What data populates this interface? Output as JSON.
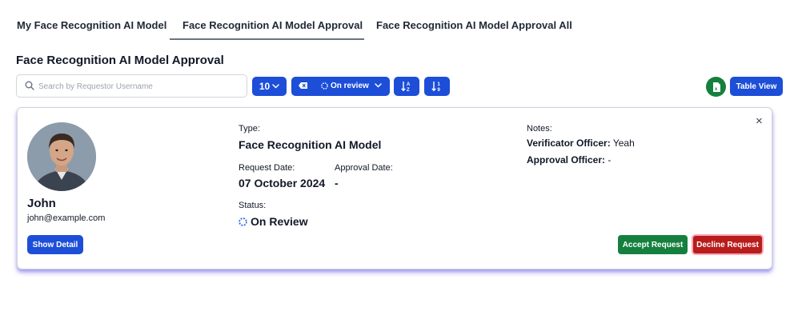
{
  "tabs": [
    {
      "label": "My Face Recognition AI Model"
    },
    {
      "label": "Face Recognition AI Model Approval"
    },
    {
      "label": "Face Recognition AI Model Approval All"
    }
  ],
  "active_tab": "Face Recognition AI Model Approval",
  "page_title": "Face Recognition AI Model Approval",
  "toolbar": {
    "search_placeholder": "Search by Requestor Username",
    "search_value": "",
    "page_size": "10",
    "status_filter": "On review",
    "table_view_label": "Table View",
    "icons": {
      "search": "search-icon",
      "page_size": "chevron-down-icon",
      "clear_filter": "backspace-icon",
      "status": "spinner-icon",
      "sort_alpha": "sort-alpha-icon",
      "sort_numeric": "sort-numeric-icon",
      "excel": "excel-icon"
    }
  },
  "request_card": {
    "user": {
      "name": "John",
      "email": "john@example.com"
    },
    "show_detail_label": "Show Detail",
    "type_label": "Type:",
    "type_value": "Face Recognition AI Model",
    "request_date_label": "Request Date:",
    "request_date_value": "07 October 2024",
    "approval_date_label": "Approval Date:",
    "approval_date_value": "-",
    "status_label": "Status:",
    "status_value": "On Review",
    "notes_label": "Notes:",
    "verificator_label": "Verificator Officer:",
    "verificator_value": "Yeah",
    "approval_officer_label": "Approval Officer:",
    "approval_officer_value": "-",
    "close_symbol": "×",
    "accept_label": "Accept Request",
    "decline_label": "Decline Request"
  },
  "colors": {
    "primary": "#1d4ed8",
    "success": "#15803d",
    "danger": "#b91c1c",
    "card_shadow": "#4f46e5"
  }
}
